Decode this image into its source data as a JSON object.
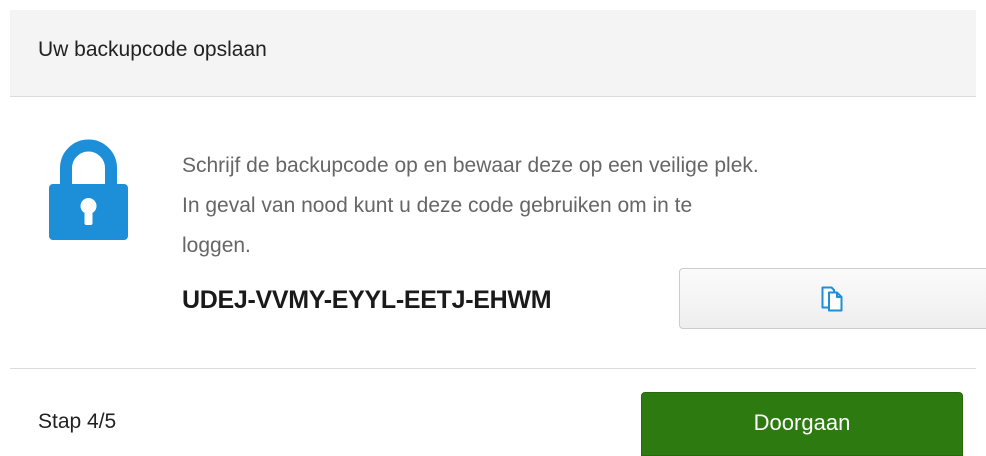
{
  "dialog": {
    "title": "Uw backupcode opslaan",
    "instruction_lines": [
      "Schrijf de backupcode op en bewaar deze op een veilige plek.",
      "In geval van nood kunt u deze code gebruiken om in te",
      "loggen."
    ],
    "backup_code": "UDEJ-VVMY-EYYL-EETJ-EHWM",
    "step": "Stap 4/5",
    "continue_label": "Doorgaan"
  },
  "icons": {
    "lock": "lock-icon",
    "copy": "copy-icon"
  },
  "colors": {
    "accent_blue": "#1c8fd8",
    "primary_green": "#2d7a10",
    "header_bg": "#f4f4f4",
    "instruction_text": "#666666"
  }
}
